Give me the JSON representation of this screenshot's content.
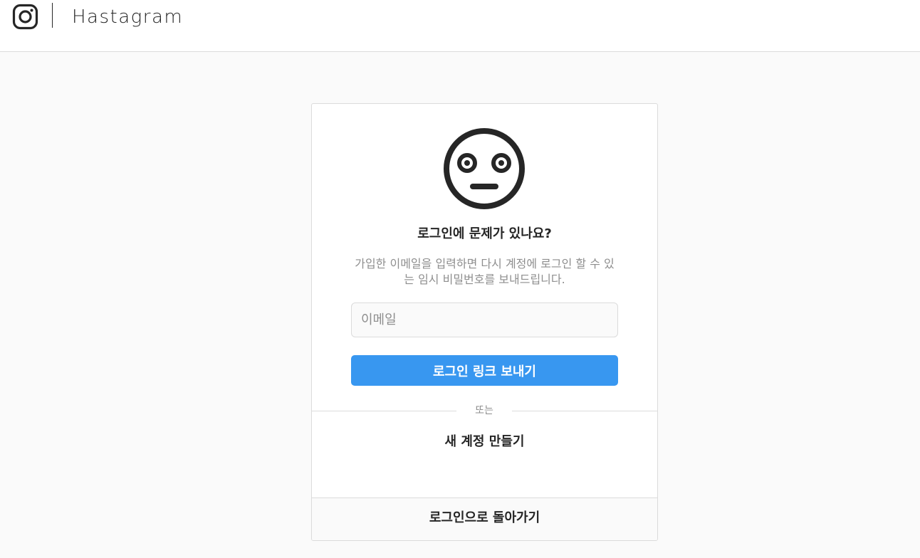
{
  "header": {
    "logo_icon": "camera-icon",
    "brand": "Hastagram"
  },
  "card": {
    "face_icon": "flushed-face-icon",
    "title": "로그인에 문제가 있나요?",
    "description": "가입한 이메일을 입력하면 다시 계정에 로그인 할 수 있는 임시 비밀번호를 보내드립니다.",
    "email_input": {
      "placeholder": "이메일",
      "value": ""
    },
    "send_button_label": "로그인 링크 보내기",
    "divider_text": "또는",
    "create_account_label": "새 계정 만들기",
    "back_to_login_label": "로그인으로 돌아가기"
  },
  "colors": {
    "primary_button": "#3897f0",
    "text": "#262626",
    "muted_text": "#8e8e8e",
    "border": "#dbdbdb",
    "background": "#fafafa"
  }
}
